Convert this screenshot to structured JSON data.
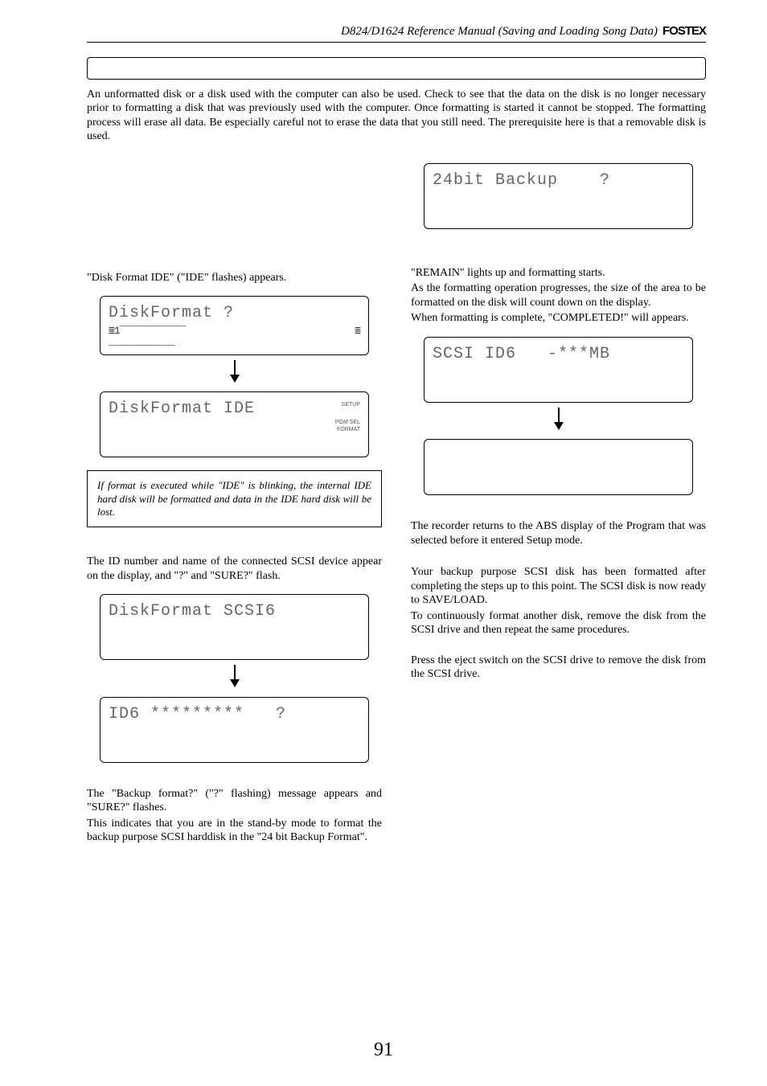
{
  "header": {
    "title": "D824/D1624 Reference Manual (Saving and Loading Song Data)",
    "brand": "FOSTEX"
  },
  "intro": "An unformatted disk or a disk used with the computer can also be used.  Check to see that the data on the disk is no longer necessary prior to formatting a disk that was previously used with the computer.  Once formatting is started it cannot be stopped.  The formatting process will erase all data.  Be especially careful not to erase the data that you still need.  The prerequisite here is that a removable disk is used.",
  "left": {
    "p1": "\"Disk Format IDE\" (\"IDE\" flashes) appears.",
    "lcd1": "DiskFormat ?",
    "lcd1_meters": "1",
    "lcd2": "DiskFormat IDE",
    "lcd2_label1": "SETUP",
    "lcd2_label2": "PGM SEL\nFORMAT",
    "caution": "If format is executed while \"IDE\" is blinking, the internal IDE hard disk will be formatted and data in the IDE hard disk will be lost.",
    "p2": "The ID number and name of the connected SCSI device appear on the display, and \"?\" and \"SURE?\" flash.",
    "lcd3": "DiskFormat SCSI6",
    "lcd4": "ID6 *********   ?",
    "p3a": "The \"Backup format?\" (\"?\" flashing) message appears and \"SURE?\" flashes.",
    "p3b": "This indicates that you are in the stand-by mode to format the backup purpose SCSI harddisk in the \"24 bit Backup Format\"."
  },
  "right": {
    "lcd5": "24bit Backup    ?",
    "p4a": "\"REMAIN\" lights up and formatting starts.",
    "p4b": "As the formatting operation progresses, the size of the area to be formatted on the disk will count down on the display.",
    "p4c": "When formatting is complete, \"COMPLETED!\" will appears.",
    "lcd6": "SCSI ID6   -***MB",
    "p5": "The recorder returns to the ABS display of the Program that was selected before it entered Setup mode.",
    "p6": "Your backup purpose SCSI disk has been formatted after completing the steps up to this point.  The SCSI disk is now ready to SAVE/LOAD.",
    "p7": "To continuously format another disk, remove the disk from the SCSI drive and then repeat the same procedures.",
    "p8": "Press the eject switch on the SCSI drive to remove the disk from the SCSI drive."
  },
  "page_number": "91"
}
